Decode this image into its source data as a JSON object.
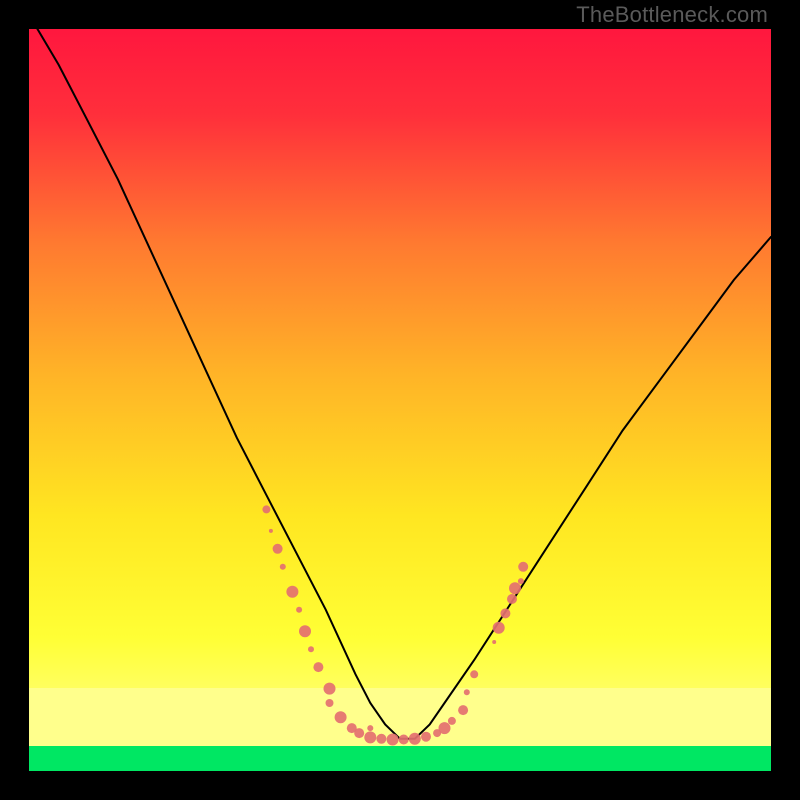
{
  "watermark": "TheBottleneck.com",
  "chart_data": {
    "type": "line",
    "title": "",
    "subtitle": "",
    "xlabel": "",
    "ylabel": "",
    "xlim": [
      0,
      100
    ],
    "ylim": [
      0,
      100
    ],
    "grid": false,
    "background_gradient": {
      "top_color": "#ff173e",
      "mid_color": "#ffe621",
      "bottom_band_color": "#ffff8c",
      "stripe_color": "#00e763"
    },
    "series": [
      {
        "name": "bottleneck-v-curve",
        "note": "V-shaped curve. Y values approximate vertical position where 100=top, 0=bottom stripe. X 0-100 across plot area.",
        "x": [
          0,
          4,
          8,
          12,
          16,
          20,
          24,
          28,
          32,
          36,
          40,
          44,
          46,
          48,
          50,
          52,
          54,
          56,
          60,
          65,
          70,
          75,
          80,
          85,
          90,
          95,
          100
        ],
        "y": [
          102,
          95,
          87,
          79,
          70,
          61,
          52,
          43,
          35,
          27,
          19,
          10,
          6,
          3,
          1,
          1,
          3,
          6,
          12,
          20,
          28,
          36,
          44,
          51,
          58,
          65,
          71
        ],
        "stroke": "#000000",
        "stroke_width": 2
      }
    ],
    "overlay_dots": {
      "name": "sample-points",
      "color": "#e47070",
      "radius_range": [
        2,
        8
      ],
      "note": "Pink/salmon dotted cluster along the bottom of the V and up both shoulders. x 0-100, y 0-100, r in px.",
      "points": [
        {
          "x": 32.0,
          "y": 33.0,
          "r": 4
        },
        {
          "x": 32.6,
          "y": 30.0,
          "r": 2
        },
        {
          "x": 33.5,
          "y": 27.5,
          "r": 5
        },
        {
          "x": 34.2,
          "y": 25.0,
          "r": 3
        },
        {
          "x": 35.5,
          "y": 21.5,
          "r": 6
        },
        {
          "x": 36.4,
          "y": 19.0,
          "r": 3
        },
        {
          "x": 37.2,
          "y": 16.0,
          "r": 6
        },
        {
          "x": 38.0,
          "y": 13.5,
          "r": 3
        },
        {
          "x": 39.0,
          "y": 11.0,
          "r": 5
        },
        {
          "x": 40.5,
          "y": 8.0,
          "r": 6
        },
        {
          "x": 40.5,
          "y": 6.0,
          "r": 4
        },
        {
          "x": 42.0,
          "y": 4.0,
          "r": 6
        },
        {
          "x": 43.5,
          "y": 2.5,
          "r": 5
        },
        {
          "x": 44.5,
          "y": 1.8,
          "r": 5
        },
        {
          "x": 46.0,
          "y": 1.2,
          "r": 6
        },
        {
          "x": 46.0,
          "y": 2.5,
          "r": 3
        },
        {
          "x": 47.5,
          "y": 1.0,
          "r": 5
        },
        {
          "x": 49.0,
          "y": 0.9,
          "r": 6
        },
        {
          "x": 50.5,
          "y": 0.9,
          "r": 5
        },
        {
          "x": 52.0,
          "y": 1.0,
          "r": 6
        },
        {
          "x": 53.5,
          "y": 1.3,
          "r": 5
        },
        {
          "x": 55.0,
          "y": 1.8,
          "r": 4
        },
        {
          "x": 56.0,
          "y": 2.5,
          "r": 6
        },
        {
          "x": 57.0,
          "y": 3.5,
          "r": 4
        },
        {
          "x": 58.5,
          "y": 5.0,
          "r": 5
        },
        {
          "x": 59.0,
          "y": 7.5,
          "r": 3
        },
        {
          "x": 60.0,
          "y": 10.0,
          "r": 4
        },
        {
          "x": 62.7,
          "y": 14.5,
          "r": 2
        },
        {
          "x": 63.3,
          "y": 16.5,
          "r": 6
        },
        {
          "x": 64.2,
          "y": 18.5,
          "r": 5
        },
        {
          "x": 65.1,
          "y": 20.5,
          "r": 5
        },
        {
          "x": 65.5,
          "y": 22.0,
          "r": 6
        },
        {
          "x": 66.3,
          "y": 23.0,
          "r": 3
        },
        {
          "x": 66.6,
          "y": 25.0,
          "r": 5
        }
      ]
    }
  }
}
